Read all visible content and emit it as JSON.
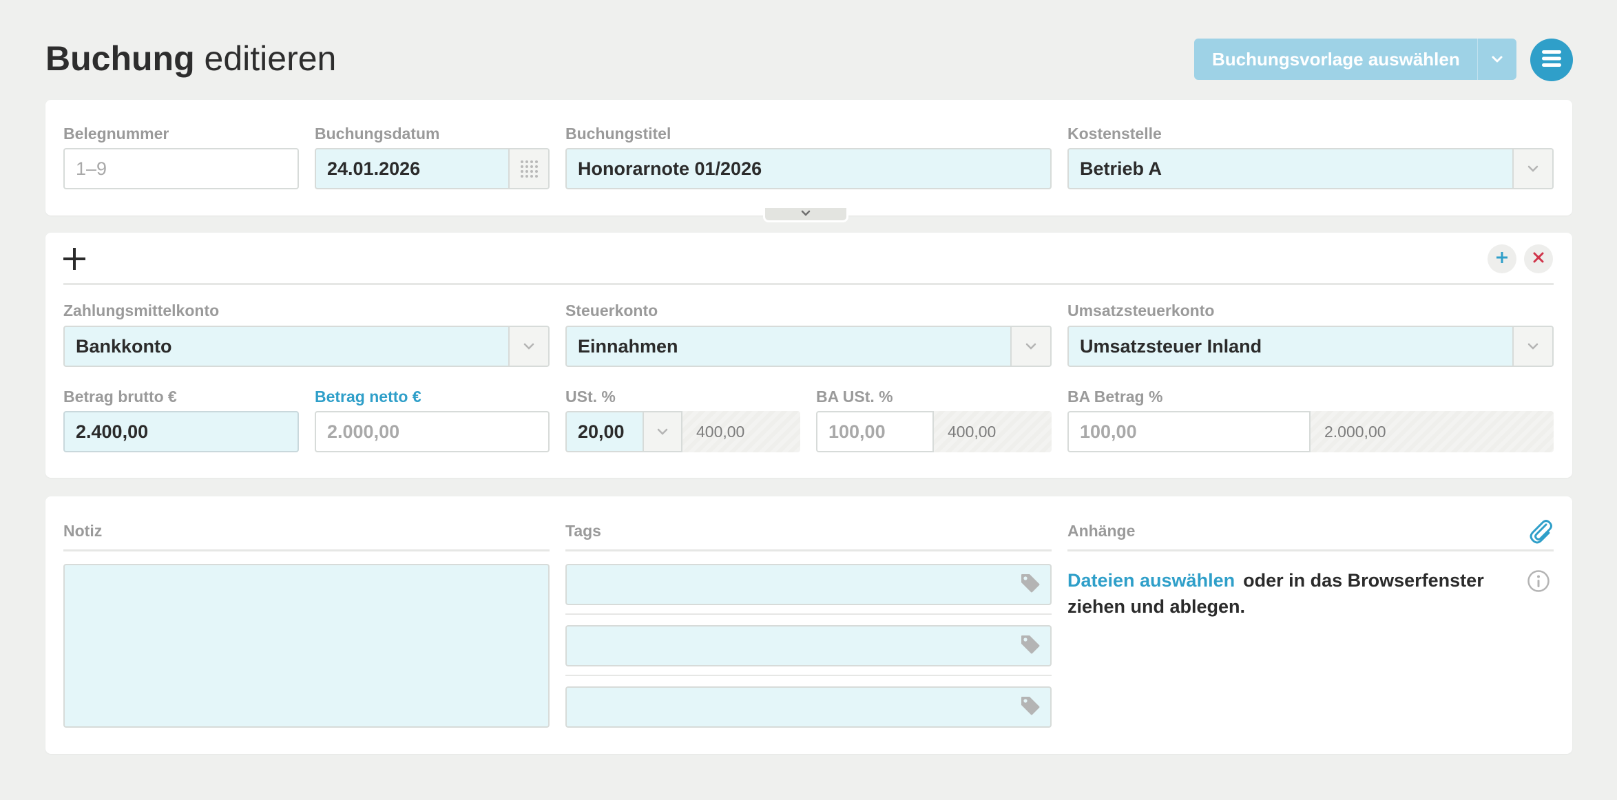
{
  "page": {
    "title_bold": "Buchung",
    "title_rest": "editieren"
  },
  "header": {
    "template_button": "Buchungsvorlage auswählen"
  },
  "meta": {
    "belegnummer": {
      "label": "Belegnummer",
      "placeholder": "1–9"
    },
    "buchungsdatum": {
      "label": "Buchungsdatum",
      "value": "24.01.2026"
    },
    "buchungstitel": {
      "label": "Buchungstitel",
      "value": "Honorarnote 01/2026"
    },
    "kostenstelle": {
      "label": "Kostenstelle",
      "value": "Betrieb A"
    }
  },
  "line": {
    "zahlungsmittelkonto": {
      "label": "Zahlungsmittelkonto",
      "value": "Bankkonto"
    },
    "steuerkonto": {
      "label": "Steuerkonto",
      "value": "Einnahmen"
    },
    "umsatzsteuerkonto": {
      "label": "Umsatzsteuerkonto",
      "value": "Umsatzsteuer Inland"
    },
    "betrag_brutto": {
      "label": "Betrag brutto €",
      "value": "2.400,00"
    },
    "betrag_netto": {
      "label": "Betrag netto €",
      "placeholder": "2.000,00"
    },
    "ust": {
      "label": "USt. %",
      "value": "20,00",
      "computed": "400,00"
    },
    "ba_ust": {
      "label": "BA USt. %",
      "placeholder": "100,00",
      "computed": "400,00"
    },
    "ba_betrag": {
      "label": "BA Betrag %",
      "placeholder": "100,00",
      "computed": "2.000,00"
    }
  },
  "extras": {
    "notiz_label": "Notiz",
    "tags_label": "Tags",
    "anhaenge_label": "Anhänge",
    "attach_link": "Dateien auswählen",
    "attach_text": "oder in das Browserfenster ziehen und ablegen."
  },
  "colors": {
    "accent": "#2f9fc9",
    "accent_light": "#9ed2e6",
    "field_fill": "#e4f6f9",
    "danger": "#d0344a"
  }
}
